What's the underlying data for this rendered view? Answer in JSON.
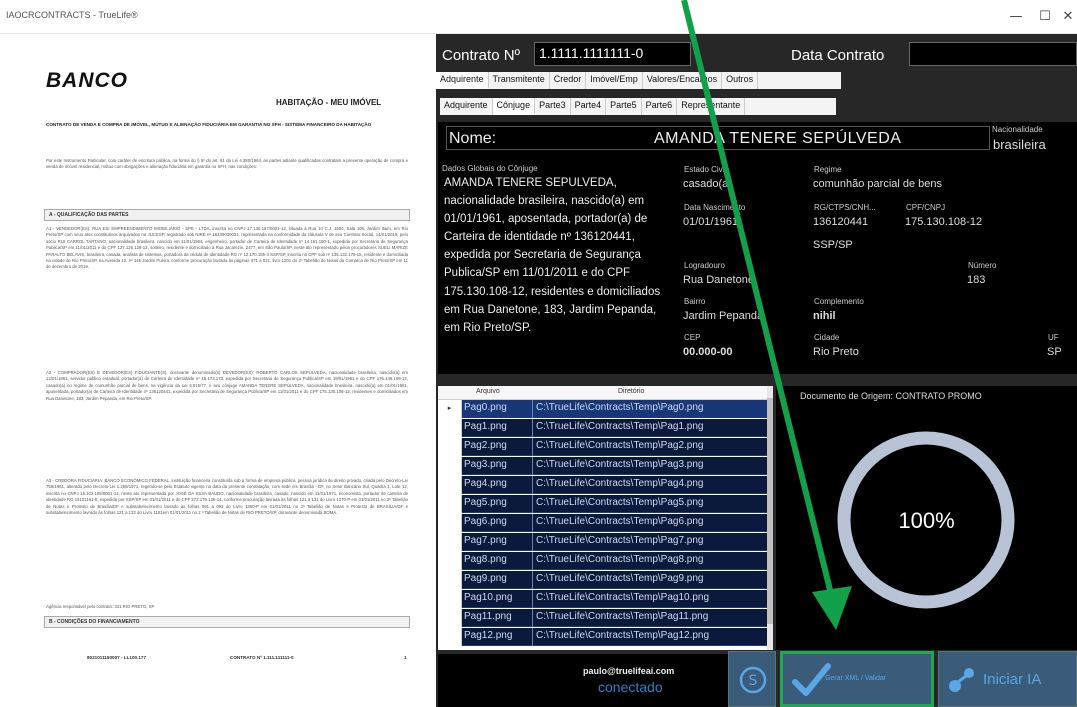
{
  "window": {
    "title": "IAOCRCONTRACTS - TrueLife®",
    "minimize": "—",
    "maximize": "☐",
    "close": "✕"
  },
  "document": {
    "bank": "BANCO",
    "program": "HABITAÇÃO - MEU IMÓVEL",
    "contract_title": "CONTRATO DE VENDA E COMPRA DE IMÓVEL, MÚTUO E ALIENAÇÃO FIDUCIÁRIA EM GARANTIA NO SFH - SISTEMA FINANCEIRO DA HABITAÇÃO",
    "intro": "Por este Instrumento Particular, com caráter de escritura pública, na forma do § 5º do art. 61 da Lei 4.380/1964, as partes adiante qualificadas contratam a presente operação de compra e venda de imóvel residencial, mútuo com obrigações e alienação fiduciária em garantia no SFH, nas condições:",
    "section_a": "A - QUALIFICAÇÃO DAS PARTES",
    "a1": "A1 - VENDEDOR(ES): RUA ESI EMPREENDIMENTO IMOBILIÁRIO - SPE - LTDA, inscrita no CNPJ 17.130.167/0001-12, situada à Rua 10 C.J. 1500, Sala 106, Jardim Itaim, em Rio Preto/SP com seus atos constitutivos arquivados na JUCESP, registrado sob NIRE nº 16235030031, representada na conformidade da cláusula V de seu Contrato Social, 14/01/2019, pelo sócio RUI CARROL TARTANO, nacionalidade brasileira, nascido em 11/01/1964, engenheiro, portador de Carteira de Identidade nº 14.151.190-1, expedida por Secretaria de Segurança Publica/SP em 11/01/2011 e do CPF 127.126.128-13, solteiro, residente e domiciliado à Rua Jacarezin, 2477, em São Paulo/SP, neste ato representado pelos procuradores SUELI MARIZE PARALTO BELAVIS, brasileira, casada, analista de sistemas, portadora da cédula de identidade RG nº 12.170.155-3 SSP/SP, inscrita no CPF sob nº 135.132.178-15, residente e domiciliada na cidade de Rio Preto/SP, na Avenida 10, nº 146 Jardim Pueira, conforme procuração lavrada às páginas 071 a 021, livro 1201 do 2º Tabelião de Notas da Comarca de Rio Preto/SP em 11 de dezembro de 2019.",
    "a2": "A2 - COMPRADOR(ES) E DEVEDOR(ES) FIDUCIANTE(S), doravante denominado(s) DEVEDOR(ES): ROBERTO CARLOS SEPÚLVEDA, nacionalidade brasileira, nascido(a) em 12/01/1961, servidor público estadual, portador(a) de Carteira de Identidade nº 15.173.173, expedida por Secretaria de Segurança Publica/SP em 19/01/1961 e do CPF 176.146.108-12, casado(a) no regime de comunhão parcial de bens, na vigência da Lei 6.515/77, e seu cônjuge AMANDA TENERE SEPÚLVEDA, nacionalidade brasileira, nascido(a) em 01/01/1961, aposentada, portador(a) de Carteira de Identidade nº 136120441, expedida por Secretaria de Segurança Publica/SP em 11/01/2011 e do CPF 175.130.108-12, residentes e domiciliados em Rua Danetone, 183, Jardim Pepanda, em Rio Preto/SP.",
    "a3": "A3 - CREDORA FIDUCIÁRIA: BANCO ECONÔMICO FEDERAL, instituição financeira constituída sob a forma de empresa pública, pessoa jurídica de direito privado, criada pelo Decreto-Lei 759/1961, alterado pelo Decreto-Lei 1.259/1971, regendo-se pelo Estatuto vigente na data da presente contratação, com sede em Brasília - DF, no Setor Bancário Sul, Quadra 1, Lote 12, inscrita no CNPJ 15.102.105/0001-14, neste ato representada por JOSÉ DA SILVA BAUDO, nacionalidade brasileira, casado, nascido em 11/01/1971, economista, portador de carteira de identidade RG 15101161-8, expedida por SSP/SP em 01/01/2011 e do CPF 272.176.136-14, conforme procuração lavrada às folhas 121 a 131 do Livro 1370-P em 01/01/2011 no 2º Tabelião de Notas e Protesto de Brasília/DF e substabelecimento lavrado às folhas 091 a 093 do Livro 1360-P em 01/01/2011 no 2º Tabelião de Notas e Protesto de BRASÍLIA/DF e substabelecimento lavrado às folhas 121 a 133 do Livro 1181em 01/01/2011 no 2 º Tabelião de Notas de RIO PRETO/SP, doravante denominada BOMA.",
    "agency": "Agência responsável pelo contrato: 331 RIO PRETO, SP",
    "section_b": "B - CONDIÇÕES DO FINANCIAMENTO",
    "footer_left": "8021011150007 - LL100.177",
    "footer_mid": "CONTRATO Nº 1.111.111111-0",
    "footer_right": "1"
  },
  "form": {
    "contract_label": "Contrato Nº",
    "contract_value": "1.1111.1111111-0",
    "date_label": "Data Contrato",
    "date_value": "",
    "tabs_main": [
      "Adquirente",
      "Transmitente",
      "Credor",
      "Imóvel/Emp",
      "Valores/Encargos",
      "Outros"
    ],
    "tabs_sub": [
      "Adquirente",
      "Cônjuge",
      "Parte3",
      "Parte4",
      "Parte5",
      "Parte6",
      "Representante"
    ],
    "nome_label": "Nome:",
    "nome_value": "AMANDA TENERE SEPÚLVEDA",
    "nacionalidade_label": "Nacionalidade",
    "nacionalidade_value": "brasileira",
    "dados_label": "Dados Globais do Cônjuge",
    "dados_value": "AMANDA TENERE SEPULVEDA, nacionalidade brasileira, nascido(a) em 01/01/1961, aposentada, portador(a) de Carteira de identidade nº 136120441, expedida por Secretaria de Segurança Publica/SP em 11/01/2011 e do CPF 175.130.108-12, residentes e domiciliados em Rua Danetone, 183, Jardim Pepanda, em Rio Preto/SP.",
    "estado_civil_label": "Estado Civil",
    "estado_civil_value": "casado(a)",
    "regime_label": "Regime",
    "regime_value": "comunhão parcial de bens",
    "data_nasc_label": "Data Nascimento",
    "data_nasc_value": "01/01/1961",
    "rg_label": "RG/CTPS/CNH...",
    "rg_value": "136120441",
    "orgao_value": "SSP/SP",
    "cpf_label": "CPF/CNPJ",
    "cpf_value": "175.130.108-12",
    "logradouro_label": "Logradouro",
    "logradouro_value": "Rua Danetone",
    "numero_label": "Número",
    "numero_value": "183",
    "bairro_label": "Bairro",
    "bairro_value": "Jardim Pepanda",
    "complemento_label": "Complemento",
    "complemento_value": "nihil",
    "cep_label": "CEP",
    "cep_value": "00.000-00",
    "cidade_label": "Cidade",
    "cidade_value": "Rio Preto",
    "uf_label": "UF",
    "uf_value": "SP"
  },
  "files": {
    "col_arquivo": "Arquivo",
    "col_diretorio": "Diretório",
    "rows": [
      {
        "name": "Pag0.png",
        "path": "C:\\TrueLife\\Contracts\\Temp\\Pag0.png"
      },
      {
        "name": "Pag1.png",
        "path": "C:\\TrueLife\\Contracts\\Temp\\Pag1.png"
      },
      {
        "name": "Pag2.png",
        "path": "C:\\TrueLife\\Contracts\\Temp\\Pag2.png"
      },
      {
        "name": "Pag3.png",
        "path": "C:\\TrueLife\\Contracts\\Temp\\Pag3.png"
      },
      {
        "name": "Pag4.png",
        "path": "C:\\TrueLife\\Contracts\\Temp\\Pag4.png"
      },
      {
        "name": "Pag5.png",
        "path": "C:\\TrueLife\\Contracts\\Temp\\Pag5.png"
      },
      {
        "name": "Pag6.png",
        "path": "C:\\TrueLife\\Contracts\\Temp\\Pag6.png"
      },
      {
        "name": "Pag7.png",
        "path": "C:\\TrueLife\\Contracts\\Temp\\Pag7.png"
      },
      {
        "name": "Pag8.png",
        "path": "C:\\TrueLife\\Contracts\\Temp\\Pag8.png"
      },
      {
        "name": "Pag9.png",
        "path": "C:\\TrueLife\\Contracts\\Temp\\Pag9.png"
      },
      {
        "name": "Pag10.png",
        "path": "C:\\TrueLife\\Contracts\\Temp\\Pag10.png"
      },
      {
        "name": "Pag11.png",
        "path": "C:\\TrueLife\\Contracts\\Temp\\Pag11.png"
      },
      {
        "name": "Pag12.png",
        "path": "C:\\TrueLife\\Contracts\\Temp\\Pag12.png"
      }
    ]
  },
  "progress": {
    "origin_label": "Documento de Origem: CONTRATO PROMO",
    "percent_text": "100%",
    "fraction": 1.0
  },
  "status": {
    "email": "paulo@truelifeai.com",
    "connection": "conectado"
  },
  "buttons": {
    "dollar_icon": "S",
    "gerar_label": "Gerar XML / Validar",
    "iniciar_label": "Iniciar IA"
  },
  "colors": {
    "accent": "#2a80c8",
    "arrow": "#12a04a",
    "highlight_border": "#1fa84f"
  }
}
